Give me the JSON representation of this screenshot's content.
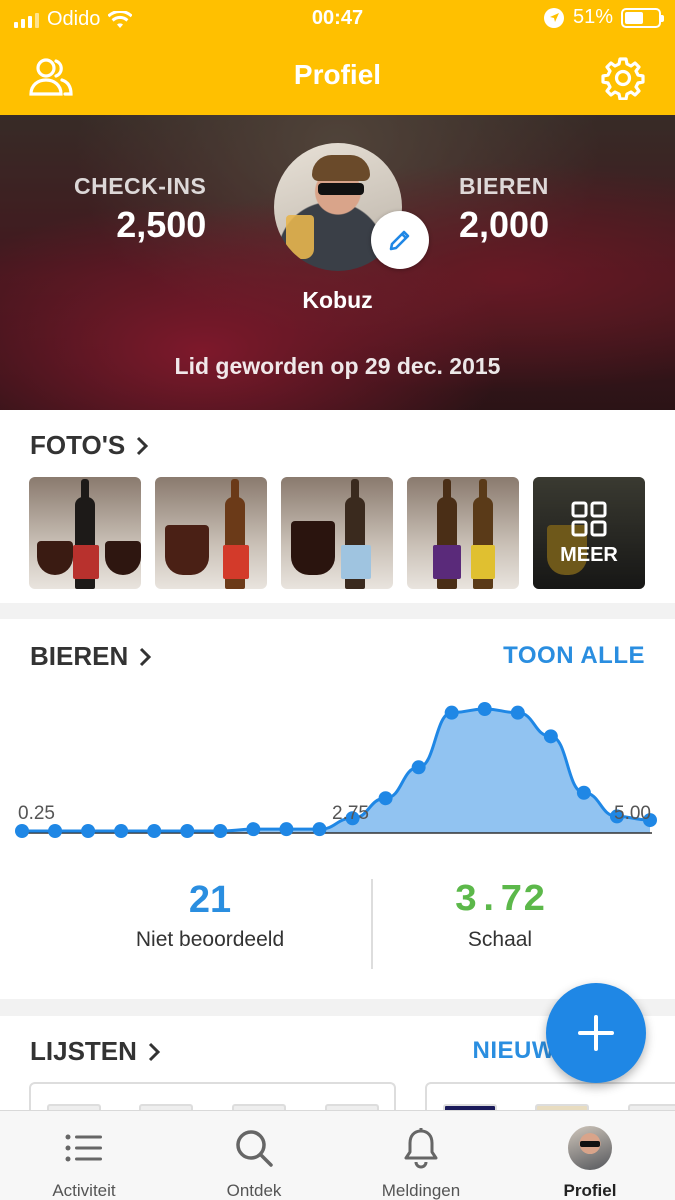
{
  "status_bar": {
    "carrier": "Odido",
    "time": "00:47",
    "battery": "51%",
    "battery_level": 0.51
  },
  "nav": {
    "title": "Profiel",
    "left_icon": "friends-icon",
    "right_icon": "gear-icon"
  },
  "profile": {
    "checkins_label": "CHECK-INS",
    "checkins_value": "2,500",
    "beers_label": "BIEREN",
    "beers_value": "2,000",
    "username": "Kobuz",
    "joined": "Lid geworden op 29 dec. 2015"
  },
  "photos": {
    "title": "FOTO'S",
    "more_label": "MEER",
    "count": 5
  },
  "beers": {
    "title": "BIEREN",
    "link": "TOON ALLE",
    "axis_ticks": [
      "0.25",
      "2.75",
      "5.00"
    ],
    "unrated_value": "21",
    "unrated_label": "Niet beoordeeld",
    "scale_value": "3.72",
    "scale_label": "Schaal",
    "accent_blue": "#2a8ee0",
    "accent_green": "#5cb84a"
  },
  "chart_data": {
    "type": "area",
    "x": [
      0.25,
      0.5,
      0.75,
      1.0,
      1.25,
      1.5,
      1.75,
      2.0,
      2.25,
      2.5,
      2.75,
      3.0,
      3.25,
      3.5,
      3.75,
      4.0,
      4.25,
      4.5,
      4.75,
      5.0
    ],
    "y": [
      0,
      0,
      0,
      0,
      0,
      0,
      0,
      1,
      1,
      1,
      7,
      18,
      35,
      65,
      67,
      65,
      52,
      21,
      8,
      6
    ],
    "xlim": [
      0.25,
      5.0
    ],
    "title": "",
    "xlabel": "",
    "ylabel": ""
  },
  "lists": {
    "title": "LIJSTEN",
    "link": "NIEUW"
  },
  "tabbar": {
    "tabs": [
      {
        "label": "Activiteit",
        "icon": "list-icon"
      },
      {
        "label": "Ontdek",
        "icon": "search-icon"
      },
      {
        "label": "Meldingen",
        "icon": "bell-icon"
      },
      {
        "label": "Profiel",
        "icon": "avatar-icon"
      }
    ]
  }
}
